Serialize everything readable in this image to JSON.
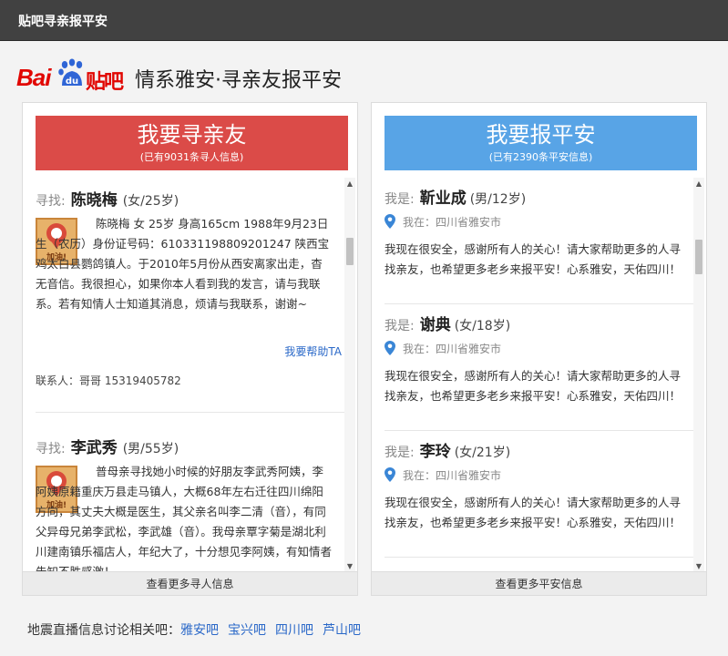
{
  "window": {
    "title": "贴吧寻亲报平安"
  },
  "brand": {
    "logo_bai": "Bai",
    "logo_du": "du",
    "logo_tieba": "贴吧",
    "slogan": "情系雅安·寻亲友报平安"
  },
  "left": {
    "button_main": "我要寻亲友",
    "button_sub": "(已有9031条寻人信息)",
    "badge_text": "加油!",
    "items": [
      {
        "prefix": "寻找:",
        "name": "陈晓梅",
        "meta": "(女/25岁)",
        "desc": "陈晓梅 女 25岁 身高165cm 1988年9月23日生（农历）身份证号码：610331198809201247 陕西宝鸡太白县鹦鸽镇人。于2010年5月份从西安离家出走，杳无音信。我很担心，如果你本人看到我的发言，请与我联系。若有知情人士知道其消息，烦请与我联系，谢谢~",
        "help": "我要帮助TA",
        "contact": "联系人：哥哥 15319405782"
      },
      {
        "prefix": "寻找:",
        "name": "李武秀",
        "meta": "(男/55岁)",
        "desc": "普母亲寻找她小时候的好朋友李武秀阿姨，李阿姨原籍重庆万县走马镇人，大概68年左右迁往四川绵阳方向，其丈夫大概是医生，其父亲名叫李二清（音），有同父异母兄弟李武松，李武雄（音）。我母亲覃字菊是湖北利川建南镇乐福店人，年纪大了，十分想见李阿姨，有知情者告知不胜感激！",
        "help": "",
        "contact": ""
      }
    ],
    "more_label": "查看更多寻人信息",
    "scroll_up": "▲",
    "scroll_down": "▼"
  },
  "right": {
    "button_main": "我要报平安",
    "button_sub": "(已有2390条平安信息)",
    "items": [
      {
        "prefix": "我是:",
        "name": "靳业成",
        "meta": "(男/12岁)",
        "location": "我在：四川省雅安市",
        "message": "我现在很安全，感谢所有人的关心！请大家帮助更多的人寻找亲友，也希望更多老乡来报平安！心系雅安，天佑四川！"
      },
      {
        "prefix": "我是:",
        "name": "谢典",
        "meta": "(女/18岁)",
        "location": "我在：四川省雅安市",
        "message": "我现在很安全，感谢所有人的关心！请大家帮助更多的人寻找亲友，也希望更多老乡来报平安！心系雅安，天佑四川！"
      },
      {
        "prefix": "我是:",
        "name": "李玲",
        "meta": "(女/21岁)",
        "location": "我在：四川省雅安市",
        "message": "我现在很安全，感谢所有人的关心！请大家帮助更多的人寻找亲友，也希望更多老乡来报平安！心系雅安，天佑四川！"
      }
    ],
    "more_label": "查看更多平安信息",
    "scroll_up": "▲",
    "scroll_down": "▼"
  },
  "footer": {
    "label": "地震直播信息讨论相关吧：",
    "links": [
      "雅安吧",
      "宝兴吧",
      "四川吧",
      "芦山吧"
    ]
  },
  "colors": {
    "red_button": "#db4b48",
    "blue_button": "#58a4e6",
    "link": "#2a68c8",
    "titlebar": "#414141",
    "pin": "#3a86d6"
  }
}
